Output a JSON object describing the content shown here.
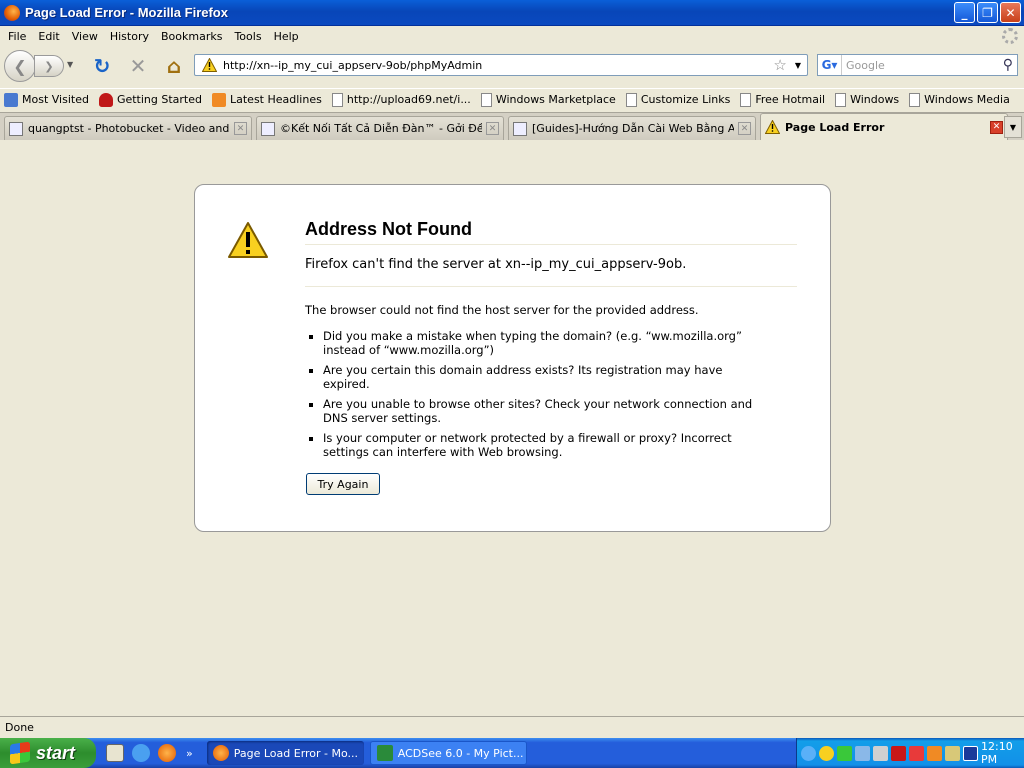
{
  "window": {
    "title": "Page Load Error - Mozilla Firefox"
  },
  "menu": [
    "File",
    "Edit",
    "View",
    "History",
    "Bookmarks",
    "Tools",
    "Help"
  ],
  "nav": {
    "url": "http://xn--ip_my_cui_appserv-9ob/phpMyAdmin",
    "search_placeholder": "Google"
  },
  "bookmarks": [
    "Most Visited",
    "Getting Started",
    "Latest Headlines",
    "http://upload69.net/i...",
    "Windows Marketplace",
    "Customize Links",
    "Free Hotmail",
    "Windows",
    "Windows Media"
  ],
  "tabs": [
    {
      "label": "quangptst - Photobucket - Video and I...",
      "active": false
    },
    {
      "label": "©Kết Nối Tất Cả Diễn Đàn™ - Gởi Đề T...",
      "active": false
    },
    {
      "label": "[Guides]-Hướng Dẫn Cài Web Bằng Ap...",
      "active": false
    },
    {
      "label": "Page Load Error",
      "active": true
    }
  ],
  "error": {
    "title": "Address Not Found",
    "short": "Firefox can't find the server at xn--ip_my_cui_appserv-9ob.",
    "intro": "The browser could not find the host server for the provided address.",
    "bullets": [
      "Did you make a mistake when typing the domain? (e.g. “ww.mozilla.org” instead of “www.mozilla.org”)",
      "Are you certain this domain address exists? Its registration may have expired.",
      "Are you unable to browse other sites? Check your network connection and DNS server settings.",
      "Is your computer or network protected by a firewall or proxy? Incorrect settings can interfere with Web browsing."
    ],
    "button": "Try Again"
  },
  "status": "Done",
  "taskbar": {
    "start": "start",
    "tasks": [
      "Page Load Error - Mo...",
      "ACDSee 6.0 - My Pict..."
    ],
    "clock": "12:10 PM"
  }
}
